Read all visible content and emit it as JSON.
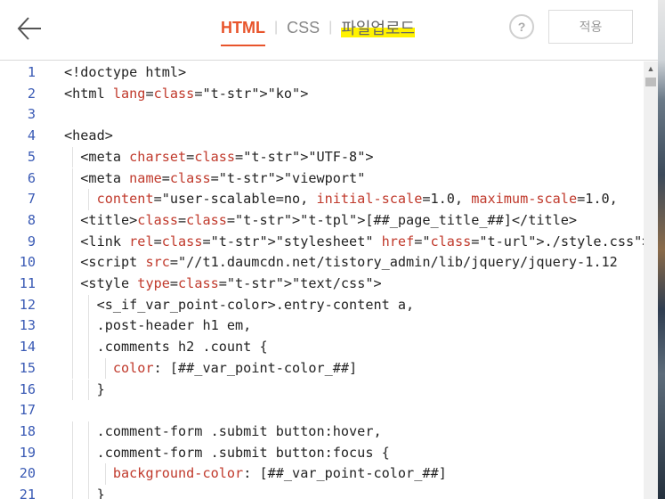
{
  "header": {
    "back_icon": "arrow-left-icon",
    "tabs": [
      {
        "label": "HTML",
        "active": true
      },
      {
        "label": "CSS",
        "active": false
      },
      {
        "label": "파일업로드",
        "active": false,
        "highlight": "#fff200"
      }
    ],
    "help_label": "?",
    "apply_label": "적용",
    "accent_color": "#e8542b"
  },
  "editor": {
    "line_numbers": [
      "1",
      "2",
      "3",
      "4",
      "5",
      "6",
      "7",
      "8",
      "9",
      "10",
      "11",
      "12",
      "13",
      "14",
      "15",
      "16",
      "17",
      "18",
      "19",
      "20",
      "21"
    ],
    "lines": [
      "<!doctype html>",
      "<html lang=\"ko\">",
      "",
      "<head>",
      "  <meta charset=\"UTF-8\">",
      "  <meta name=\"viewport\"",
      "    content=\"user-scalable=no, initial-scale=1.0, maximum-scale=1.0,",
      "  <title>[##_page_title_##]</title>",
      "  <link rel=\"stylesheet\" href=\"./style.css\">",
      "  <script src=\"//t1.daumcdn.net/tistory_admin/lib/jquery/jquery-1.12",
      "  <style type=\"text/css\">",
      "    <s_if_var_point-color>.entry-content a,",
      "    .post-header h1 em,",
      "    .comments h2 .count {",
      "      color: [##_var_point-color_##]",
      "    }",
      "",
      "    .comment-form .submit button:hover,",
      "    .comment-form .submit button:focus {",
      "      background-color: [##_var_point-color_##]",
      "    }"
    ]
  }
}
